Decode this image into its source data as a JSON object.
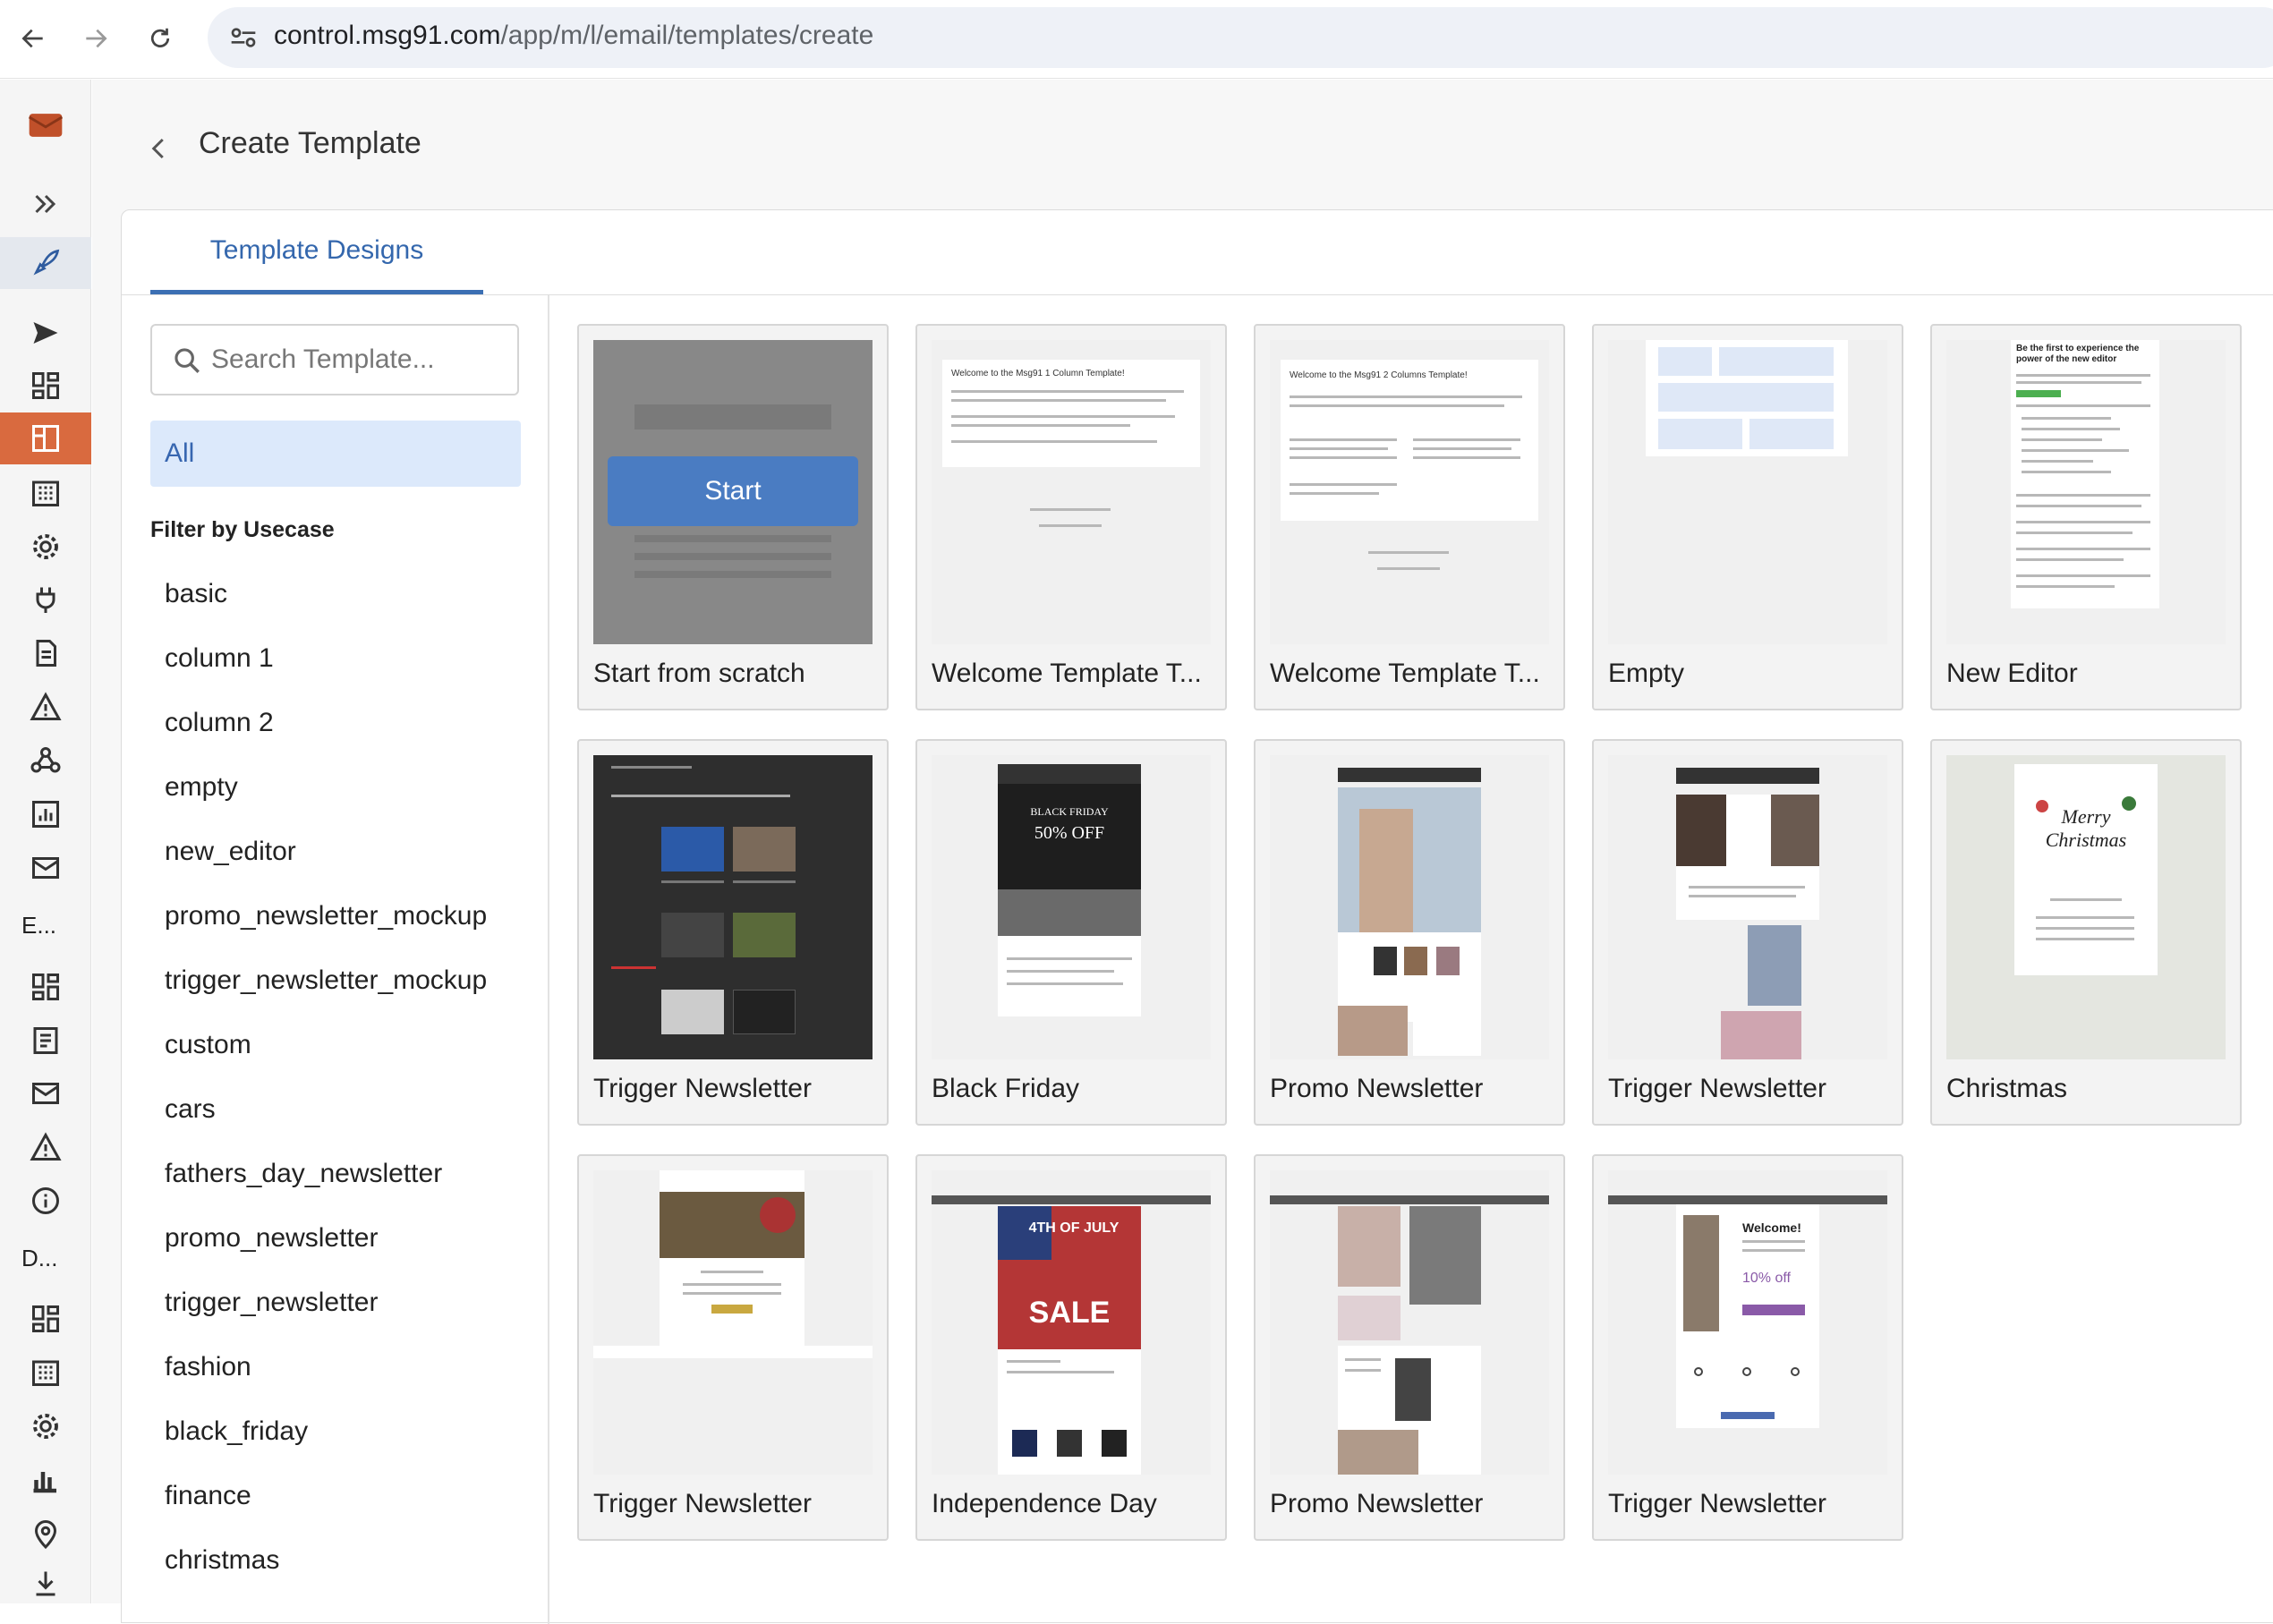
{
  "browser": {
    "url_host": "control.msg91.com",
    "url_path": "/app/m/l/email/templates/create"
  },
  "sidebar": {
    "label_e": "E...",
    "label_d": "D..."
  },
  "page": {
    "title": "Create Template",
    "tab": "Template Designs"
  },
  "filters": {
    "search_placeholder": "Search Template...",
    "all_label": "All",
    "heading": "Filter by Usecase",
    "items": [
      "basic",
      "column 1",
      "column 2",
      "empty",
      "new_editor",
      "promo_newsletter_mockup",
      "trigger_newsletter_mockup",
      "custom",
      "cars",
      "fathers_day_newsletter",
      "promo_newsletter",
      "trigger_newsletter",
      "fashion",
      "black_friday",
      "finance",
      "christmas"
    ]
  },
  "templates": {
    "start_button": "Start",
    "names": [
      "Start from scratch",
      "Welcome Template T...",
      "Welcome Template T...",
      "Empty",
      "New Editor",
      "Trigger Newsletter",
      "Black Friday",
      "Promo Newsletter",
      "Trigger Newsletter",
      "Christmas",
      "Trigger Newsletter",
      "Independence Day",
      "Promo Newsletter",
      "Trigger Newsletter"
    ]
  },
  "thumb_text": {
    "welcome1_title": "Welcome to the Msg91 1 Column Template!",
    "welcome2_title": "Welcome to the Msg91 2 Columns Template!",
    "new_editor_title": "Be the first to experience the power of the new editor",
    "black_friday": "BLACK FRIDAY",
    "black_friday_off": "50% OFF",
    "christmas": "Merry Christmas",
    "july": "4TH OF JULY",
    "sale": "SALE",
    "welcome": "Welcome!",
    "ten_off": "10% off"
  },
  "colors": {
    "accent": "#3c6fb3",
    "sidebar_active": "#d96a3f",
    "filter_selected_bg": "#dce9fb"
  }
}
